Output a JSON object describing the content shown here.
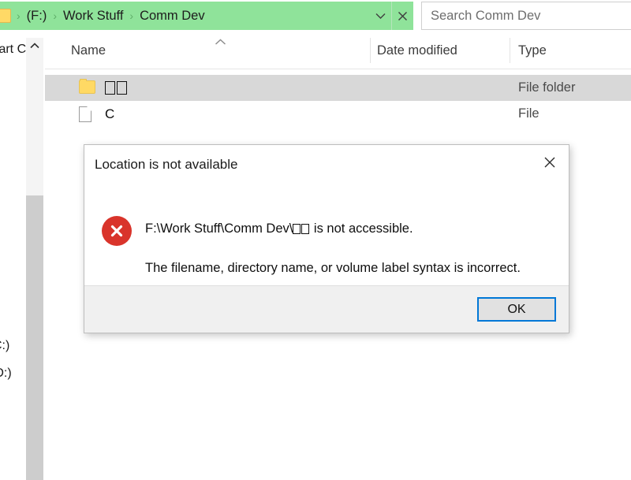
{
  "window": {
    "type": "file-explorer"
  },
  "addressbar": {
    "folder_icon": "folder-icon",
    "breadcrumbs": [
      "(F:)",
      "Work Stuff",
      "Comm Dev"
    ],
    "separator": "›",
    "dropdown_icon": "chevron-down-icon",
    "stop_icon": "close-x-icon",
    "background_color": "#8fe39a"
  },
  "search": {
    "placeholder": "Search Comm Dev"
  },
  "nav_pane": {
    "items": [
      {
        "label": "tart C"
      },
      {
        "label": "C:)"
      },
      {
        "label": "(D:)"
      }
    ],
    "scroll_up_icon": "chevron-up-icon"
  },
  "file_list": {
    "columns": [
      "Name",
      "Date modified",
      "Type"
    ],
    "sort_indicator": "chevron-up-icon",
    "rows": [
      {
        "icon": "folder-icon",
        "name": "□□",
        "name_is_tofu": true,
        "tofu_count": 2,
        "date_modified": "",
        "type": "File folder",
        "selected": true
      },
      {
        "icon": "file-icon",
        "name": "C",
        "name_is_tofu": false,
        "tofu_count": 0,
        "date_modified": "",
        "type": "File",
        "selected": false
      }
    ],
    "selection_color": "#d8d8d8"
  },
  "dialog": {
    "title": "Location is not available",
    "close_icon": "close-x-icon",
    "error_icon": "error-circle-x-icon",
    "error_icon_color": "#d9342b",
    "message_prefix": "F:\\Work Stuff\\Comm Dev\\",
    "message_tofu_count": 2,
    "message_suffix": " is not accessible.",
    "detail": "The filename, directory name, or volume label syntax is incorrect.",
    "ok_label": "OK",
    "ok_focus_color": "#0078d7"
  }
}
